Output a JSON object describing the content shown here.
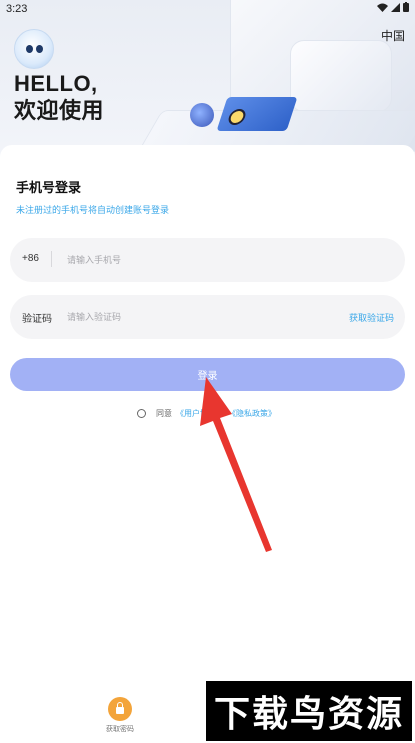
{
  "status_bar": {
    "time": "3:23"
  },
  "header": {
    "region": "中国",
    "greeting_line1": "HELLO,",
    "greeting_line2": "欢迎使用"
  },
  "login": {
    "title": "手机号登录",
    "hint": "未注册过的手机号将自动创建账号登录",
    "country_code": "+86",
    "phone_placeholder": "请输入手机号",
    "code_label": "验证码",
    "code_placeholder": "请输入验证码",
    "get_code_label": "获取验证码",
    "submit_label": "登录",
    "agree_prefix": "同意",
    "user_agreement": "《用户协议》",
    "privacy_policy": "《隐私政策》"
  },
  "bottom": {
    "key_label": "获取密码"
  },
  "watermark": {
    "text": "下载鸟资源"
  },
  "colors": {
    "accent": "#3aa7e8",
    "button": "#a2b1f5",
    "arrow": "#e8362f"
  },
  "icons": [
    "mascot-icon",
    "wifi-icon",
    "signal-icon",
    "battery-icon",
    "lock-icon",
    "arrow-pointer"
  ]
}
